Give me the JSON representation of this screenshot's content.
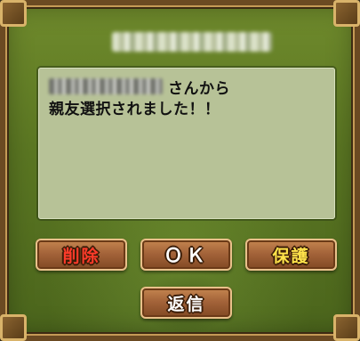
{
  "dialog": {
    "message_suffix": "さんから",
    "message_line2": "親友選択されました！！"
  },
  "buttons": {
    "delete_label": "削除",
    "ok_label": "ＯＫ",
    "protect_label": "保護",
    "reply_label": "返信"
  },
  "colors": {
    "panel_green": "#5a7622",
    "message_bg": "#b7c297",
    "button_brown": "#a4643a",
    "delete_text": "#ff3b2a",
    "protect_text": "#ffe24a",
    "ok_text": "#ffffff"
  }
}
